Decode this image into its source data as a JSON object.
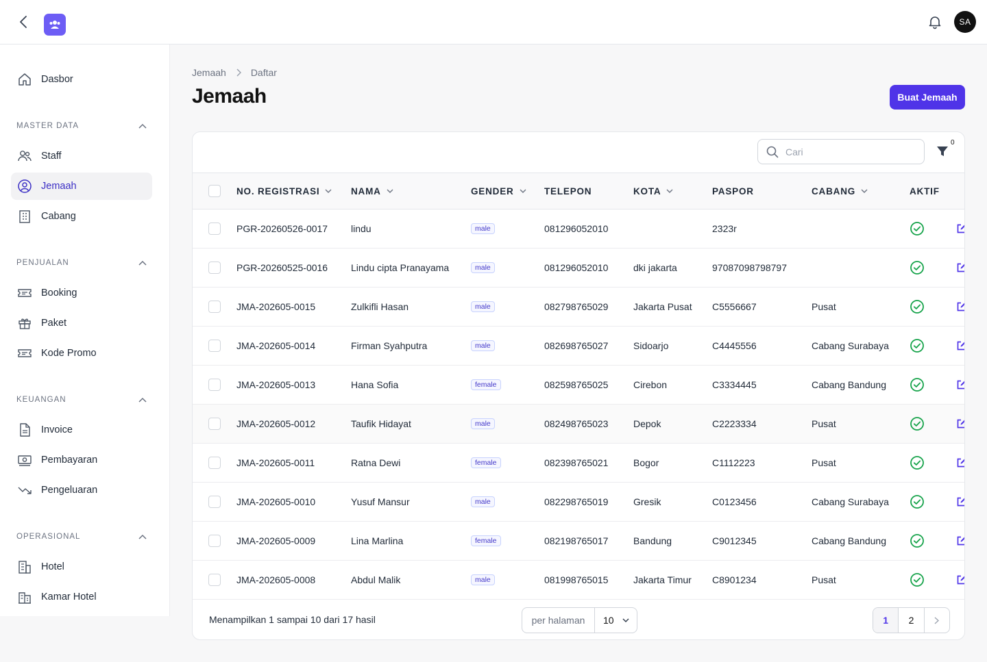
{
  "topbar": {
    "avatar_initials": "SA"
  },
  "sidebar": {
    "dashboard": "Dasbor",
    "groups": [
      {
        "label": "MASTER DATA",
        "items": [
          "Staff",
          "Jemaah",
          "Cabang"
        ]
      },
      {
        "label": "PENJUALAN",
        "items": [
          "Booking",
          "Paket",
          "Kode Promo"
        ]
      },
      {
        "label": "KEUANGAN",
        "items": [
          "Invoice",
          "Pembayaran",
          "Pengeluaran"
        ]
      },
      {
        "label": "OPERASIONAL",
        "items": [
          "Hotel",
          "Kamar Hotel"
        ]
      }
    ],
    "active_item": "Jemaah"
  },
  "breadcrumb": [
    "Jemaah",
    "Daftar"
  ],
  "page": {
    "title": "Jemaah",
    "create_button": "Buat Jemaah"
  },
  "search": {
    "placeholder": "Cari",
    "value": ""
  },
  "filter": {
    "count": "0"
  },
  "table": {
    "columns": [
      "NO. REGISTRASI",
      "NAMA",
      "GENDER",
      "TELEPON",
      "KOTA",
      "PASPOR",
      "CABANG",
      "AKTIF"
    ],
    "rows": [
      {
        "reg": "PGR-20260526-0017",
        "name": "lindu",
        "gender": "male",
        "phone": "081296052010",
        "city": "",
        "passport": "2323r",
        "branch": "",
        "active": true
      },
      {
        "reg": "PGR-20260525-0016",
        "name": "Lindu cipta Pranayama",
        "gender": "male",
        "phone": "081296052010",
        "city": "dki jakarta",
        "passport": "97087098798797",
        "branch": "",
        "active": true
      },
      {
        "reg": "JMA-202605-0015",
        "name": "Zulkifli Hasan",
        "gender": "male",
        "phone": "082798765029",
        "city": "Jakarta Pusat",
        "passport": "C5556667",
        "branch": "Pusat",
        "active": true
      },
      {
        "reg": "JMA-202605-0014",
        "name": "Firman Syahputra",
        "gender": "male",
        "phone": "082698765027",
        "city": "Sidoarjo",
        "passport": "C4445556",
        "branch": "Cabang Surabaya",
        "active": true
      },
      {
        "reg": "JMA-202605-0013",
        "name": "Hana Sofia",
        "gender": "female",
        "phone": "082598765025",
        "city": "Cirebon",
        "passport": "C3334445",
        "branch": "Cabang Bandung",
        "active": true
      },
      {
        "reg": "JMA-202605-0012",
        "name": "Taufik Hidayat",
        "gender": "male",
        "phone": "082498765023",
        "city": "Depok",
        "passport": "C2223334",
        "branch": "Pusat",
        "active": true
      },
      {
        "reg": "JMA-202605-0011",
        "name": "Ratna Dewi",
        "gender": "female",
        "phone": "082398765021",
        "city": "Bogor",
        "passport": "C1112223",
        "branch": "Pusat",
        "active": true
      },
      {
        "reg": "JMA-202605-0010",
        "name": "Yusuf Mansur",
        "gender": "male",
        "phone": "082298765019",
        "city": "Gresik",
        "passport": "C0123456",
        "branch": "Cabang Surabaya",
        "active": true
      },
      {
        "reg": "JMA-202605-0009",
        "name": "Lina Marlina",
        "gender": "female",
        "phone": "082198765017",
        "city": "Bandung",
        "passport": "C9012345",
        "branch": "Cabang Bandung",
        "active": true
      },
      {
        "reg": "JMA-202605-0008",
        "name": "Abdul Malik",
        "gender": "male",
        "phone": "081998765015",
        "city": "Jakarta Timur",
        "passport": "C8901234",
        "branch": "Pusat",
        "active": true
      }
    ]
  },
  "footer": {
    "summary": "Menampilkan 1 sampai 10 dari 17 hasil",
    "per_page_label": "per halaman",
    "per_page_value": "10",
    "pages": [
      "1",
      "2"
    ],
    "current_page": "1"
  },
  "colors": {
    "accent": "#4f34e8",
    "active_green": "#16a34a",
    "logo": "#6d5df5"
  }
}
